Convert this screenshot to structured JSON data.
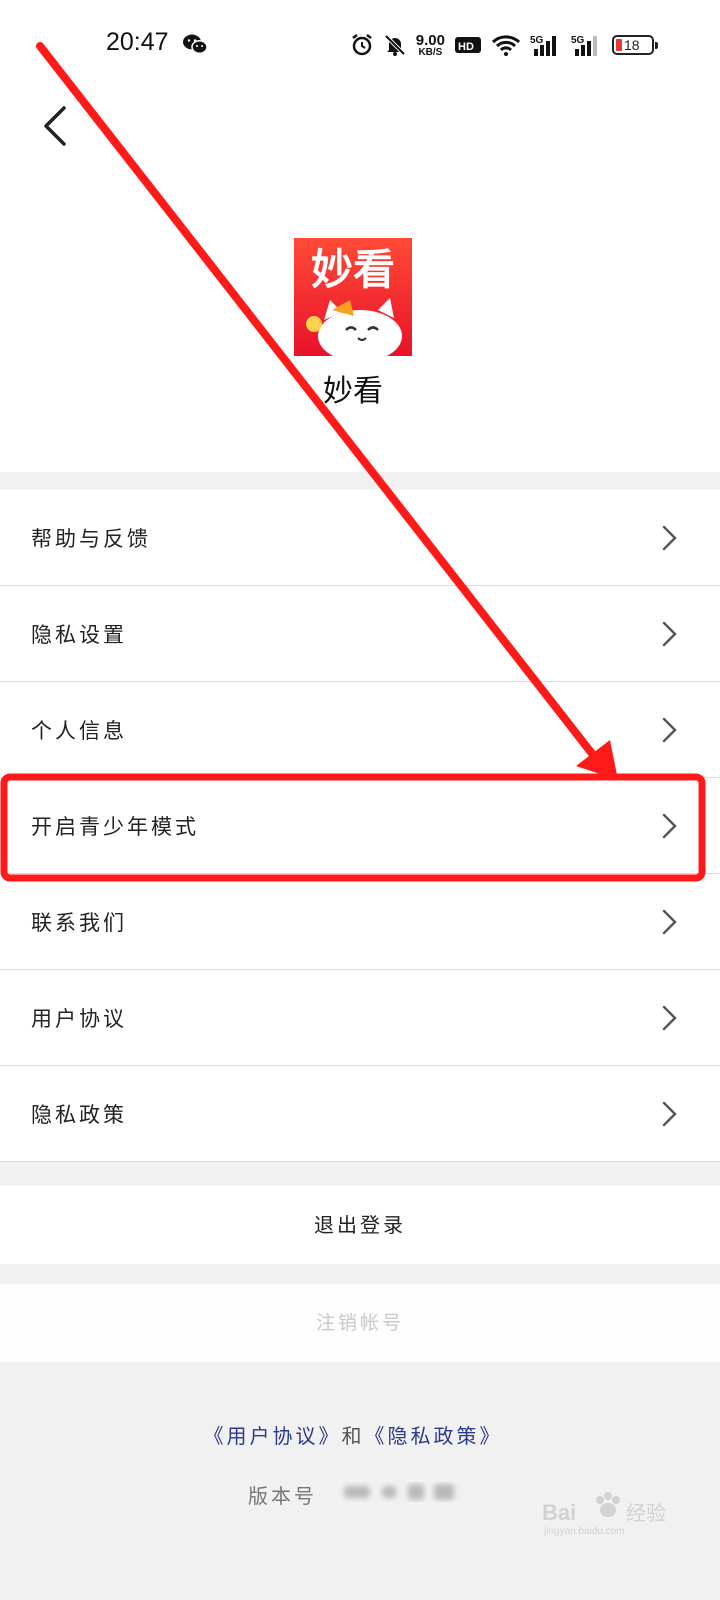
{
  "status_bar": {
    "time": "20:47",
    "net_speed_value": "9.00",
    "net_speed_unit": "KB/S",
    "hd_label": "HD",
    "signal_label": "5G",
    "battery_level": "18",
    "battery_color": "#e53935"
  },
  "header": {
    "back_icon": "chevron-left-icon",
    "logo_text": "妙看",
    "app_name": "妙看",
    "logo_colors": [
      "#ff3b2f",
      "#e8122a"
    ]
  },
  "menu": {
    "items": [
      {
        "label": "帮助与反馈"
      },
      {
        "label": "隐私设置"
      },
      {
        "label": "个人信息"
      },
      {
        "label": "开启青少年模式"
      },
      {
        "label": "联系我们"
      },
      {
        "label": "用户协议"
      },
      {
        "label": "隐私政策"
      }
    ]
  },
  "actions": {
    "logout_label": "退出登录",
    "cancel_account_label": "注销帐号"
  },
  "footer": {
    "user_agreement_link": "《用户协议》",
    "and_text": "和",
    "privacy_policy_link": "《隐私政策》",
    "version_label": "版本号"
  },
  "annotation": {
    "arrow_color": "#ff1a1a",
    "highlight_color": "#ff1a1a"
  },
  "watermark": {
    "text": "Bai du 经验",
    "subtext": "jingyan.baidu.com"
  }
}
